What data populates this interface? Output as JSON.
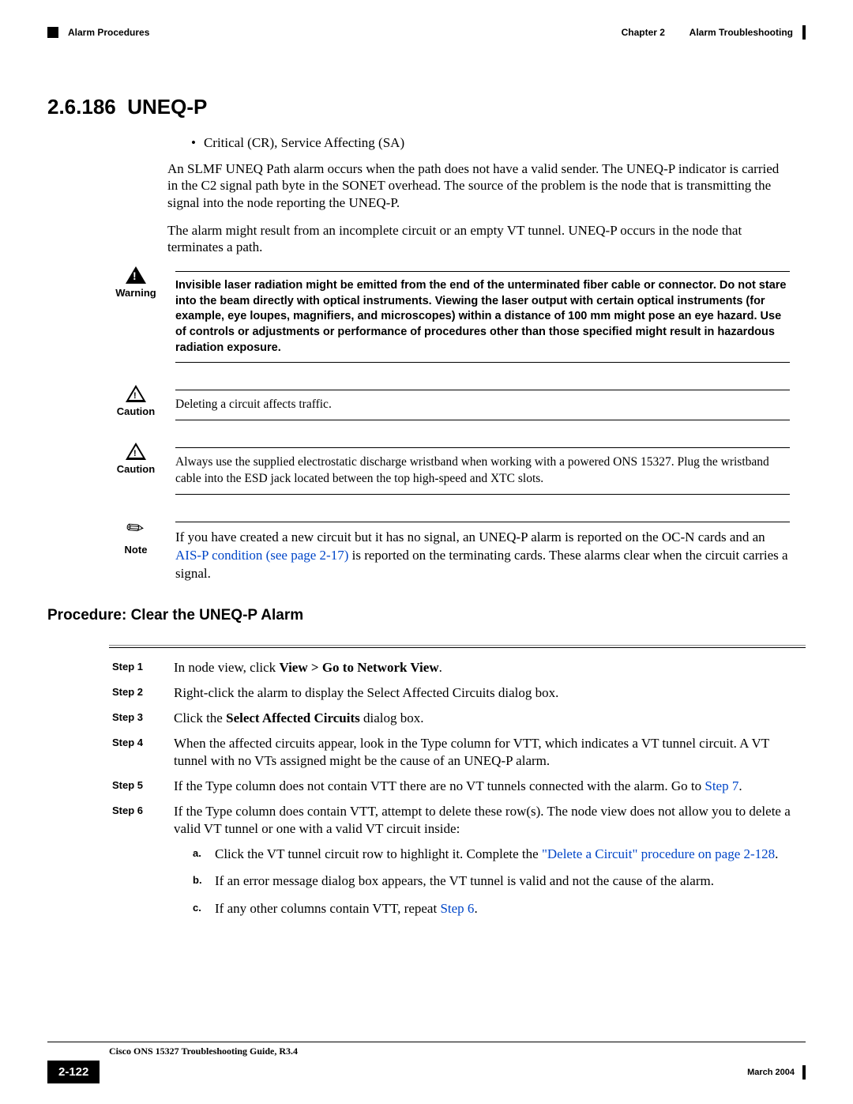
{
  "header": {
    "left": "Alarm Procedures",
    "chapter": "Chapter 2",
    "right": "Alarm Troubleshooting"
  },
  "section": {
    "number": "2.6.186",
    "title": "UNEQ-P"
  },
  "bullet": "Critical (CR), Service Affecting (SA)",
  "para1": "An SLMF UNEQ Path alarm occurs when the path does not have a valid sender. The UNEQ-P indicator is carried in the C2 signal path byte in the SONET overhead. The source of the problem is the node that is transmitting the signal into the node reporting the UNEQ-P.",
  "para2": "The alarm might result from an incomplete circuit or an empty VT tunnel. UNEQ-P occurs in the node that terminates a path.",
  "warning": {
    "label": "Warning",
    "text": "Invisible laser radiation might be emitted from the end of the unterminated fiber cable or connector. Do not stare into the beam directly with optical instruments. Viewing the laser output with certain optical instruments (for example, eye loupes, magnifiers, and microscopes) within a distance of 100 mm might pose an eye hazard. Use of controls or adjustments or performance of procedures other than those specified might result in hazardous radiation exposure."
  },
  "caution1": {
    "label": "Caution",
    "text": "Deleting a circuit affects traffic."
  },
  "caution2": {
    "label": "Caution",
    "text": "Always use the supplied electrostatic discharge wristband when working with a powered ONS 15327. Plug the wristband cable into the ESD jack located between the top high-speed and XTC slots."
  },
  "note": {
    "label": "Note",
    "pre": "If you have created a new circuit but it has no signal, an UNEQ-P alarm is reported on the OC-N cards and an ",
    "link": "AIS-P condition (see page 2-17)",
    "post": " is reported on the terminating cards. These alarms clear when the circuit carries a signal."
  },
  "procedure_title": "Procedure: Clear the UNEQ-P Alarm",
  "steps": {
    "s1_label": "Step 1",
    "s1_pre": "In node view, click ",
    "s1_bold": "View > Go to Network View",
    "s1_post": ".",
    "s2_label": "Step 2",
    "s2": "Right-click the alarm to display the Select Affected Circuits dialog box.",
    "s3_label": "Step 3",
    "s3_pre": "Click the ",
    "s3_bold": "Select Affected Circuits",
    "s3_post": " dialog box.",
    "s4_label": "Step 4",
    "s4": "When the affected circuits appear, look in the Type column for VTT, which indicates a VT tunnel circuit. A VT tunnel with no VTs assigned might be the cause of an UNEQ-P alarm.",
    "s5_label": "Step 5",
    "s5_pre": "If the Type column does not contain VTT there are no VT tunnels connected with the alarm. Go to ",
    "s5_link": "Step 7",
    "s5_post": ".",
    "s6_label": "Step 6",
    "s6": "If the Type column does contain VTT, attempt to delete these row(s). The node view does not allow you to delete a valid VT tunnel or one with a valid VT circuit inside:",
    "sa_label": "a.",
    "sa_pre": "Click the VT tunnel circuit row to highlight it. Complete the ",
    "sa_link": "\"Delete a Circuit\" procedure on page 2-128",
    "sa_post": ".",
    "sb_label": "b.",
    "sb": "If an error message dialog box appears, the VT tunnel is valid and not the cause of the alarm.",
    "sc_label": "c.",
    "sc_pre": "If any other columns contain VTT, repeat ",
    "sc_link": "Step 6",
    "sc_post": "."
  },
  "footer": {
    "title": "Cisco ONS 15327 Troubleshooting Guide, R3.4",
    "page": "2-122",
    "date": "March 2004"
  }
}
